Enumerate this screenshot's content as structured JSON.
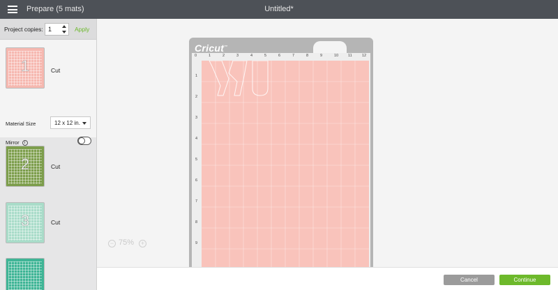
{
  "header": {
    "title": "Prepare (5 mats)",
    "document_title": "Untitled*"
  },
  "sidebar": {
    "project_copies_label": "Project copies:",
    "project_copies_value": "1",
    "apply_label": "Apply",
    "material_size_label": "Material Size",
    "material_size_value": "12 x 12 in.",
    "mirror_label": "Mirror",
    "mirror_on": false,
    "mats": [
      {
        "number": "1",
        "label": "Cut",
        "color": "#f6b8b0",
        "selected": true
      },
      {
        "number": "2",
        "label": "Cut",
        "color": "#7d9e4c",
        "selected": false
      },
      {
        "number": "3",
        "label": "Cut",
        "color": "#a9dcc9",
        "selected": false
      },
      {
        "number": "",
        "label": "",
        "color": "#3fb596",
        "selected": false
      }
    ]
  },
  "canvas": {
    "logo": "Cricut",
    "ruler_top": [
      "0",
      "1",
      "2",
      "3",
      "4",
      "5",
      "6",
      "7",
      "8",
      "9",
      "10",
      "11",
      "12"
    ],
    "ruler_left": [
      "1",
      "2",
      "3",
      "4",
      "5",
      "6",
      "7",
      "8",
      "9"
    ],
    "mat_color": "#f9c3bb",
    "zoom_level": "75%",
    "zoom_out_icon": "minus",
    "zoom_in_icon": "plus"
  },
  "footer": {
    "cancel_label": "Cancel",
    "continue_label": "Continue"
  }
}
